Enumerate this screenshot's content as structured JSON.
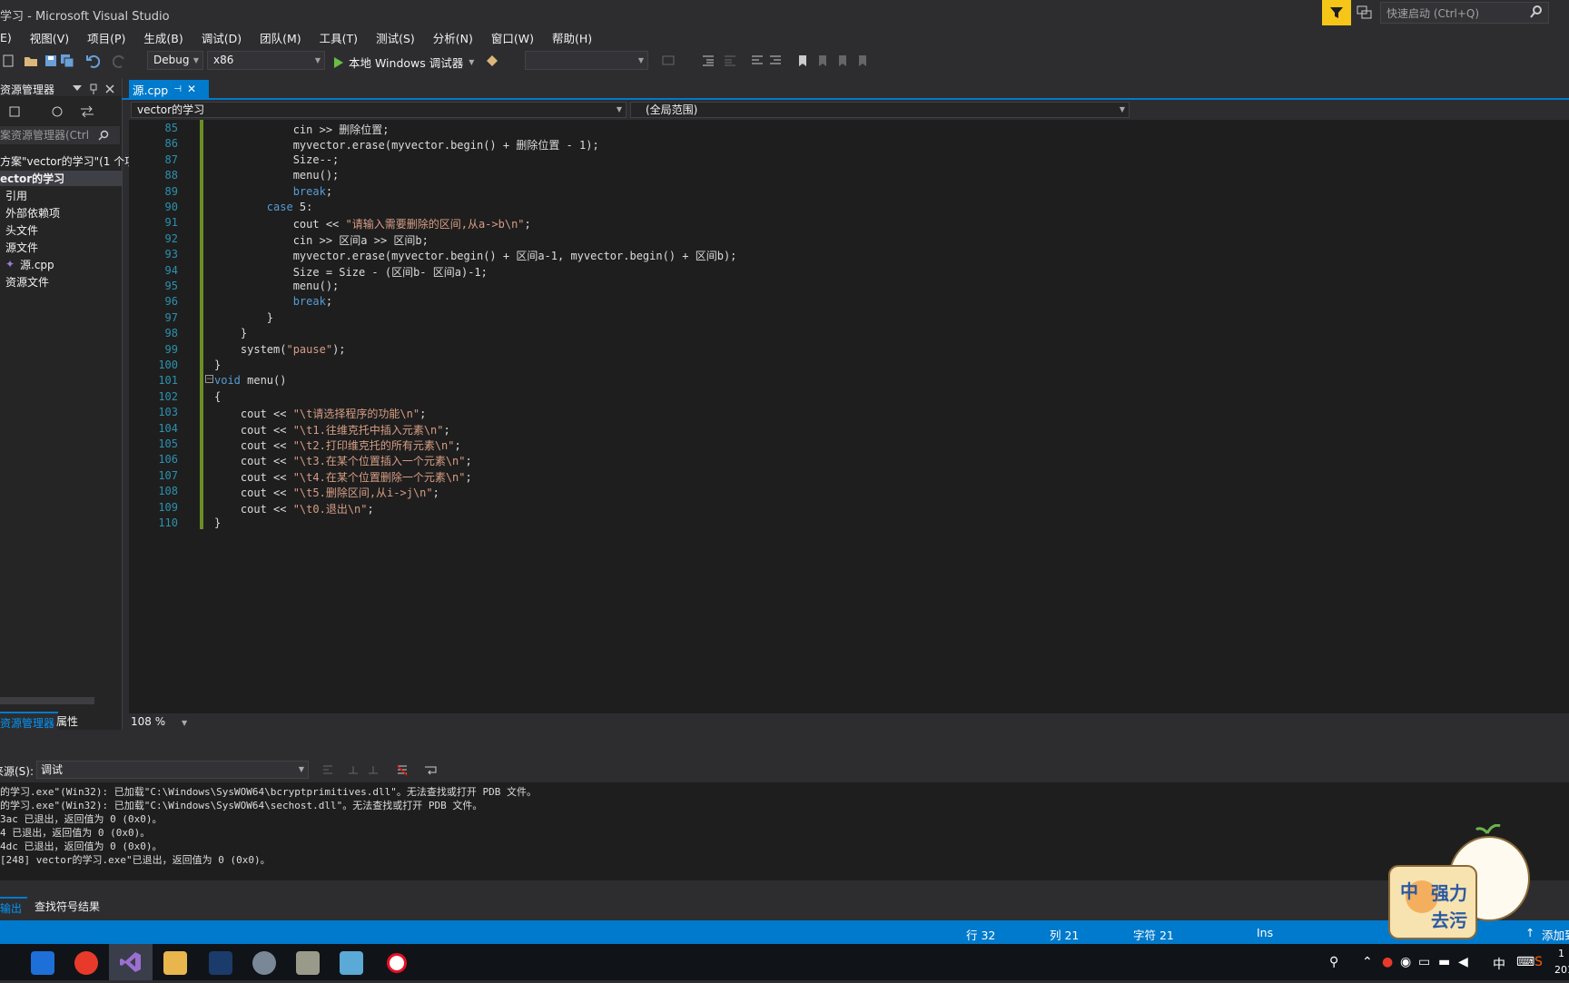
{
  "window": {
    "title": "学习 - Microsoft Visual Studio",
    "quick_launch_placeholder": "快速启动 (Ctrl+Q)"
  },
  "menu": [
    "E)",
    "视图(V)",
    "项目(P)",
    "生成(B)",
    "调试(D)",
    "团队(M)",
    "工具(T)",
    "测试(S)",
    "分析(N)",
    "窗口(W)",
    "帮助(H)"
  ],
  "toolbar": {
    "config": "Debug",
    "platform": "x86",
    "run_label": "本地 Windows 调试器"
  },
  "solution_explorer": {
    "title": "资源管理器",
    "search_placeholder": "案资源管理器(Ctrl",
    "items": [
      "方案\"vector的学习\"(1 个项",
      "ector的学习",
      "引用",
      "外部依赖项",
      "头文件",
      "源文件",
      "源.cpp",
      "资源文件"
    ],
    "bottom_tabs": [
      "资源管理器",
      "属性"
    ]
  },
  "editor": {
    "tab": "源.cpp",
    "nav_left": "vector的学习",
    "nav_scope": "(全局范围)",
    "zoom": "108 %",
    "lines": [
      {
        "n": "85",
        "html": "            cin &gt;&gt; 删除位置;"
      },
      {
        "n": "86",
        "html": "            myvector.erase(myvector.begin() + 删除位置 - 1);"
      },
      {
        "n": "87",
        "html": "            Size--;"
      },
      {
        "n": "88",
        "html": "            menu();"
      },
      {
        "n": "89",
        "html": "            <span class='kw'>break</span>;"
      },
      {
        "n": "90",
        "html": "        <span class='kw'>case</span> 5:"
      },
      {
        "n": "91",
        "html": "            cout &lt;&lt; <span class='str'>\"请输入需要删除的区间,从a->b\\n\"</span>;"
      },
      {
        "n": "92",
        "html": "            cin &gt;&gt; 区间a &gt;&gt; 区间b;"
      },
      {
        "n": "93",
        "html": "            myvector.erase(myvector.begin() + 区间a-1, myvector.begin() + 区间b);"
      },
      {
        "n": "94",
        "html": "            Size = Size - (区间b- 区间a)-1;"
      },
      {
        "n": "95",
        "html": "            menu();"
      },
      {
        "n": "96",
        "html": "            <span class='kw'>break</span>;"
      },
      {
        "n": "97",
        "html": "        }"
      },
      {
        "n": "98",
        "html": "    }"
      },
      {
        "n": "99",
        "html": "    system(<span class='str'>\"pause\"</span>);"
      },
      {
        "n": "100",
        "html": "}"
      },
      {
        "n": "101",
        "html": "<span class='kw'>void</span> menu()"
      },
      {
        "n": "102",
        "html": "{"
      },
      {
        "n": "103",
        "html": "    cout &lt;&lt; <span class='str'>\"\\t请选择程序的功能\\n\"</span>;"
      },
      {
        "n": "104",
        "html": "    cout &lt;&lt; <span class='str'>\"\\t1.往维克托中插入元素\\n\"</span>;"
      },
      {
        "n": "105",
        "html": "    cout &lt;&lt; <span class='str'>\"\\t2.打印维克托的所有元素\\n\"</span>;"
      },
      {
        "n": "106",
        "html": "    cout &lt;&lt; <span class='str'>\"\\t3.在某个位置插入一个元素\\n\"</span>;"
      },
      {
        "n": "107",
        "html": "    cout &lt;&lt; <span class='str'>\"\\t4.在某个位置删除一个元素\\n\"</span>;"
      },
      {
        "n": "108",
        "html": "    cout &lt;&lt; <span class='str'>\"\\t5.删除区间,从i->j\\n\"</span>;"
      },
      {
        "n": "109",
        "html": "    cout &lt;&lt; <span class='str'>\"\\t0.退出\\n\"</span>;"
      },
      {
        "n": "110",
        "html": "}"
      }
    ]
  },
  "output": {
    "source_label": "来源(S):",
    "source_value": "调试",
    "lines": [
      "的学习.exe\"(Win32): 已加载\"C:\\Windows\\SysWOW64\\bcryptprimitives.dll\"。无法查找或打开 PDB 文件。",
      "的学习.exe\"(Win32): 已加载\"C:\\Windows\\SysWOW64\\sechost.dll\"。无法查找或打开 PDB 文件。",
      "3ac 已退出，返回值为 0 (0x0)。",
      "4 已退出，返回值为 0 (0x0)。",
      "4dc 已退出，返回值为 0 (0x0)。",
      "[248] vector的学习.exe\"已退出，返回值为 0 (0x0)。"
    ],
    "tabs": [
      "输出",
      "查找符号结果"
    ]
  },
  "status": {
    "line": "行 32",
    "col": "列 21",
    "char": "字符 21",
    "mode": "Ins",
    "add": "添加到"
  },
  "taskbar": {
    "ime": "中",
    "time": "1",
    "date": "201"
  },
  "sticker": {
    "left": "中",
    "line1": "强力",
    "line2": "去污"
  }
}
